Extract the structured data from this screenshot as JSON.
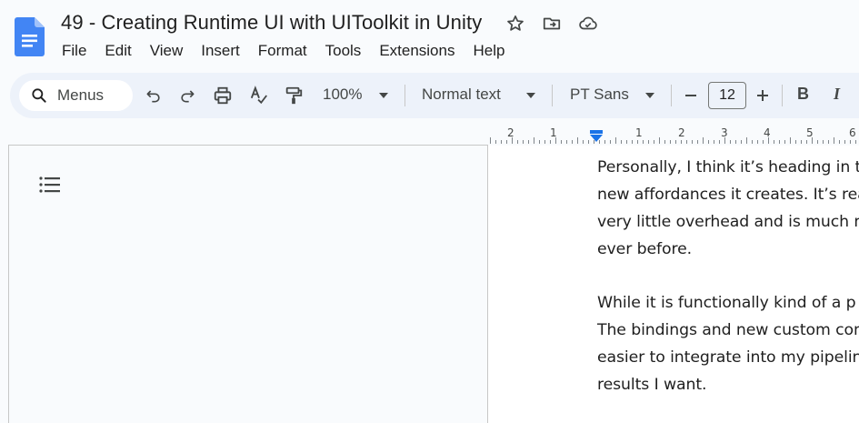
{
  "document": {
    "title": "49 - Creating Runtime UI with UIToolkit in Unity"
  },
  "menu": {
    "items": [
      "File",
      "Edit",
      "View",
      "Insert",
      "Format",
      "Tools",
      "Extensions",
      "Help"
    ]
  },
  "toolbar": {
    "search_placeholder": "Menus",
    "zoom": "100%",
    "style": "Normal text",
    "font": "PT Sans",
    "font_size": "12",
    "bold_label": "B",
    "italic_label": "I"
  },
  "ruler": {
    "numbers": [
      "2",
      "1",
      "1",
      "2",
      "3",
      "4",
      "5",
      "6"
    ]
  },
  "page": {
    "lines": [
      "Personally, I think it’s heading in t",
      "new affordances it creates. It’s rea",
      "very little overhead and is much m",
      "ever before.",
      "While it is functionally kind of a p",
      "The bindings and new custom com",
      "easier to integrate into my pipelin",
      "results I want."
    ]
  },
  "colors": {
    "accent": "#1a73e8",
    "toolbar_bg": "#edf2fa",
    "page_bg": "#ffffff",
    "canvas_bg": "#f9fbfd"
  }
}
